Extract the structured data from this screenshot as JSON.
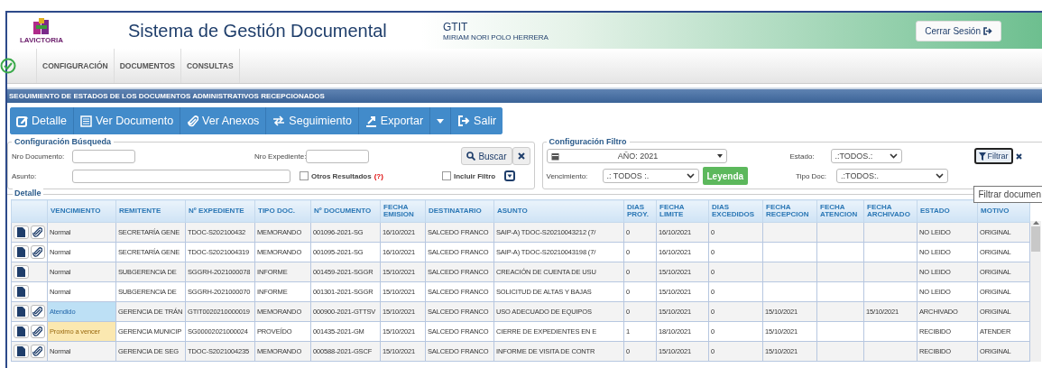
{
  "header": {
    "logo_text": "LAVICTORIA",
    "title": "Sistema de Gestión Documental",
    "unit": "GTIT",
    "user": "MIRIAM NORI POLO HERRERA",
    "logout": "Cerrar Sesión"
  },
  "menu": [
    "CONFIGURACIÓN",
    "DOCUMENTOS",
    "CONSULTAS"
  ],
  "section_title": "SEGUIMIENTO DE ESTADOS DE LOS DOCUMENTOS ADMINISTRATIVOS RECEPCIONADOS",
  "toolbar": [
    {
      "kind": "edit",
      "label": "Detalle"
    },
    {
      "kind": "list",
      "label": "Ver Documento"
    },
    {
      "kind": "clip",
      "label": "Ver Anexos"
    },
    {
      "kind": "swap",
      "label": "Seguimiento"
    },
    {
      "kind": "export",
      "label": "Exportar"
    },
    {
      "kind": "caret"
    },
    {
      "kind": "exit",
      "label": "Salir"
    }
  ],
  "search": {
    "legend": "Configuración Búsqueda",
    "doc_label": "Nro Documento:",
    "exp_label": "Nro Expediente:",
    "subject_label": "Asunto:",
    "other_results": {
      "label": "Otros Resultados",
      "help": "(?)",
      "checked": false
    },
    "search_button": "Buscar",
    "include_filter": {
      "label": "Incluir Filtro",
      "checked": false
    }
  },
  "filter": {
    "legend": "Configuración Filtro",
    "year": "AÑO: 2021",
    "due_label": "Vencimiento:",
    "due_value": ".: TODOS :.",
    "legend_button": "Leyenda",
    "state_label": "Estado:",
    "state_value": ".:TODOS.:",
    "type_label": "Tipo Doc:",
    "type_value": ".:TODOS:.",
    "filter_button": "Filtrar",
    "tooltip": "Filtrar documen"
  },
  "detail_legend": "Detalle",
  "table": {
    "columns": [
      "VENCIMIENTO",
      "REMITENTE",
      "Nº EXPEDIENTE",
      "TIPO DOC.",
      "Nº DOCUMENTO",
      "FECHA EMISION",
      "DESTINATARIO",
      "ASUNTO",
      "DIAS PROY.",
      "FECHA LIMITE",
      "DIAS EXCEDIDOS",
      "FECHA RECEPCION",
      "FECHA ATENCION",
      "FECHA ARCHIVADO",
      "ESTADO",
      "MOTIVO"
    ],
    "rows": [
      {
        "attachment": true,
        "kind": "normal",
        "cells": [
          "Normal",
          "SECRETARÍA GENE",
          "TDOC-S202100432",
          "MEMORANDO",
          "001096-2021-SG",
          "16/10/2021",
          "SALCEDO FRANCO",
          "SAIP-A) TDOC-S20210043212 (7/",
          "0",
          "16/10/2021",
          "0",
          "",
          "",
          "",
          "NO LEIDO",
          "ORIGINAL"
        ]
      },
      {
        "attachment": true,
        "kind": "normal",
        "cells": [
          "Normal",
          "SECRETARÍA GENE",
          "TDOC-S2021004319",
          "MEMORANDO",
          "001095-2021-SG",
          "16/10/2021",
          "SALCEDO FRANCO",
          "SAIP-A) TDOC-S20210043198 (7/",
          "0",
          "16/10/2021",
          "0",
          "",
          "",
          "",
          "NO LEIDO",
          "ORIGINAL"
        ]
      },
      {
        "attachment": false,
        "kind": "normal",
        "cells": [
          "Normal",
          "SUBGERENCIA DE",
          "SGGRH-2021000078",
          "INFORME",
          "001459-2021-SGGR",
          "15/10/2021",
          "SALCEDO FRANCO",
          "CREACIÓN DE CUENTA DE USU",
          "0",
          "15/10/2021",
          "0",
          "",
          "",
          "",
          "NO LEIDO",
          "ORIGINAL"
        ]
      },
      {
        "attachment": false,
        "kind": "normal",
        "cells": [
          "Normal",
          "SUBGERENCIA DE",
          "SGGRH-2021000070",
          "INFORME",
          "001301-2021-SGGR",
          "15/10/2021",
          "SALCEDO FRANCO",
          "SOLICITUD DE ALTAS Y BAJAS",
          "0",
          "15/10/2021",
          "0",
          "",
          "",
          "",
          "NO LEIDO",
          "ORIGINAL"
        ]
      },
      {
        "attachment": true,
        "kind": "attended",
        "cells": [
          "Atendido",
          "GERENCIA DE TRÁN",
          "GTIT0020210000019",
          "MEMORANDO",
          "000900-2021-GTTSV",
          "15/10/2021",
          "SALCEDO FRANCO",
          "USO ADECUADO DE EQUIPOS",
          "0",
          "15/10/2021",
          "0",
          "15/10/2021",
          "",
          "15/10/2021",
          "ARCHIVADO",
          "ORIGINAL"
        ]
      },
      {
        "attachment": true,
        "kind": "due_soon",
        "cells": [
          "Proximo a vencer",
          "GERENCIA MUNICIP",
          "SG00002021000024",
          "PROVEÍDO",
          "001435-2021-GM",
          "15/10/2021",
          "SALCEDO FRANCO",
          "CIERRE DE EXPEDIENTES EN E",
          "1",
          "18/10/2021",
          "0",
          "15/10/2021",
          "",
          "",
          "RECIBIDO",
          "ATENDER"
        ]
      },
      {
        "attachment": true,
        "kind": "normal",
        "cells": [
          "Normal",
          "GERENCIA DE SEG",
          "TDOC-S2021004235",
          "MEMORANDO",
          "000588-2021-GSCF",
          "15/10/2021",
          "SALCEDO FRANCO",
          "INFORME DE VISITA DE CONTR",
          "0",
          "15/10/2021",
          "0",
          "15/10/2021",
          "",
          "",
          "RECIBIDO",
          "ORIGINAL"
        ]
      }
    ]
  }
}
